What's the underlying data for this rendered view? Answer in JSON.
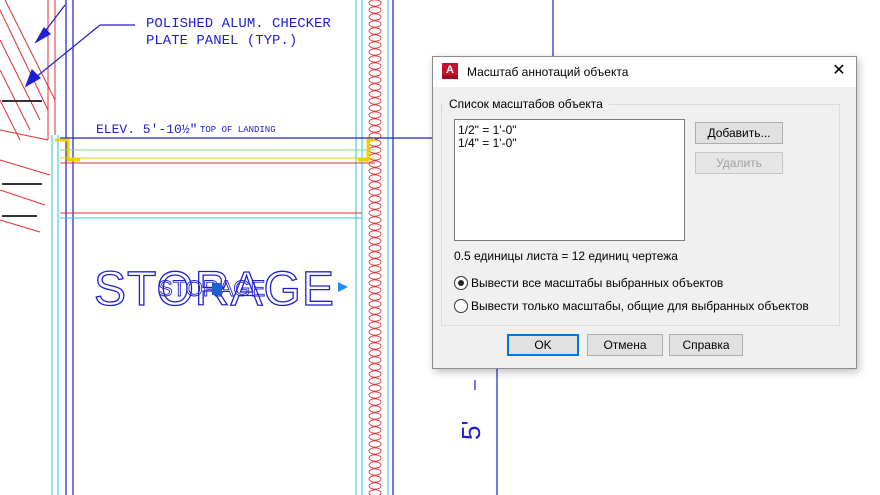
{
  "drawing": {
    "note_line1": "POLISHED ALUM. CHECKER",
    "note_line2": "PLATE PANEL (TYP.)",
    "elev_label": "ELEV. 5'-10½\"",
    "elev_sub": "TOP OF LANDING",
    "room_label": "STORAGE",
    "room_label_small": "STORAGE",
    "dim_text": "5'"
  },
  "colors": {
    "cad_blue": "#1f1fd0",
    "cad_red": "#e03030",
    "cad_cyan": "#33c0e0",
    "cad_yellow": "#f0d000",
    "cad_green": "#80e080",
    "accent": "#0078d7"
  },
  "dialog": {
    "icon_letter": "A",
    "title": "Масштаб аннотаций объекта",
    "close_icon": "close-icon",
    "group_label": "Список масштабов объекта",
    "scales": [
      "1/2\" = 1'-0\"",
      "1/4\" = 1'-0\""
    ],
    "add_label": "Добавить...",
    "delete_label": "Удалить",
    "info_text": "0.5 единицы листа = 12 единиц чертежа",
    "radio_all_label": "Вывести все масштабы выбранных объектов",
    "radio_common_label": "Вывести только масштабы, общие для выбранных объектов",
    "radio_selected": "all",
    "ok_label": "OK",
    "cancel_label": "Отмена",
    "help_label": "Справка"
  }
}
